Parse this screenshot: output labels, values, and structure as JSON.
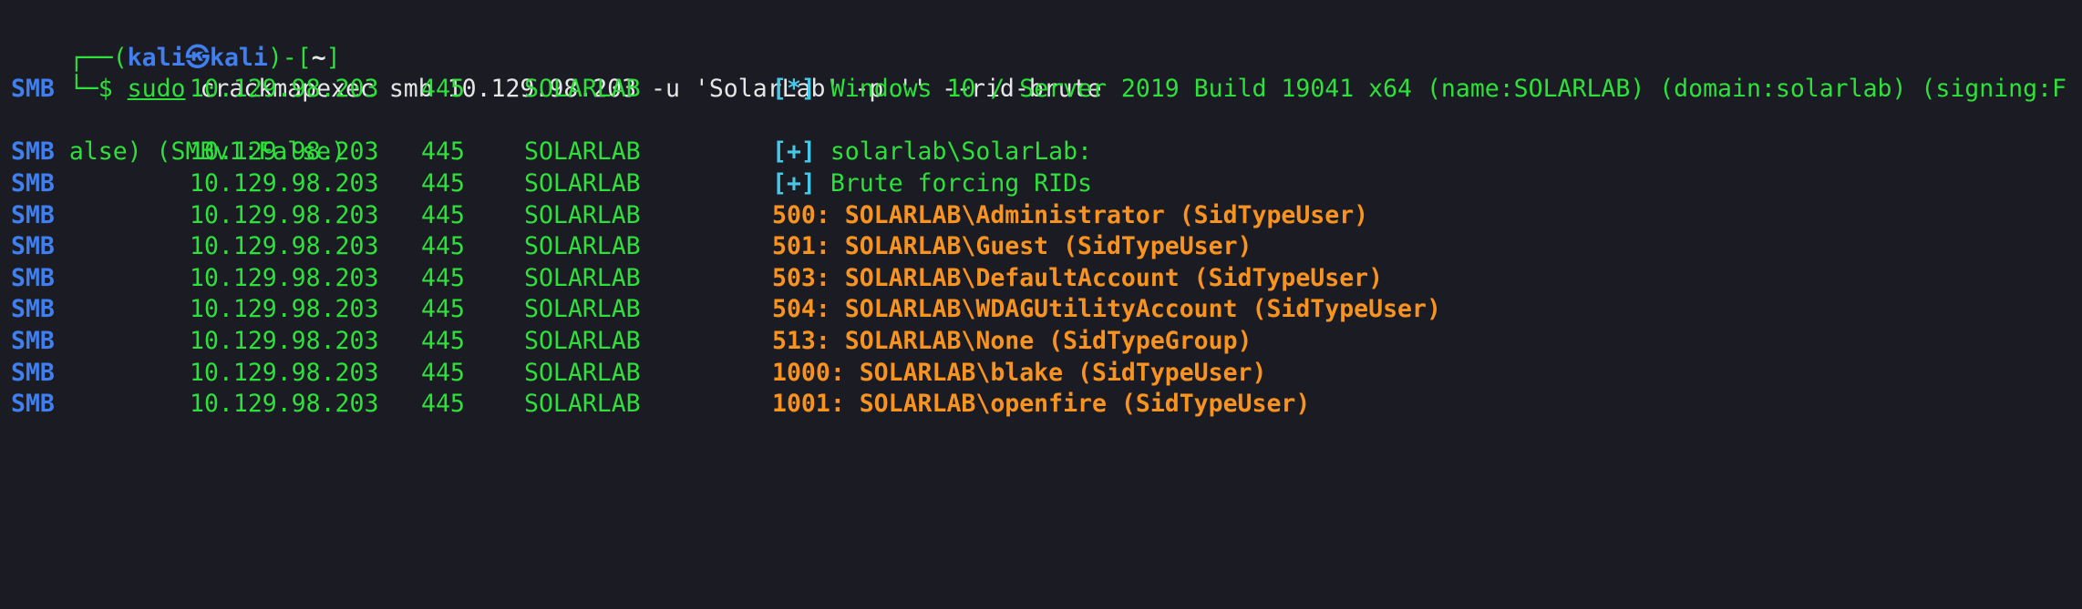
{
  "prompt": {
    "line1_prefix": "┌──(",
    "user": "kali",
    "at": "㉿",
    "host": "kali",
    "mid": ")-[",
    "path": "~",
    "end": "]",
    "line2_prefix": "└─$ ",
    "cmd_sudo": "sudo",
    "cmd_rest": " crackmapexec smb 10.129.98.203 -u 'SolarLab' -p '' --rid-brute"
  },
  "info_line": {
    "proto": "SMB",
    "ip": "10.129.98.203",
    "port": "445",
    "host": "SOLARLAB",
    "tag": "[*]",
    "text": " Windows 10 / Server 2019 Build 19041 x64 (name:SOLARLAB) (domain:solarlab) (signing:F",
    "wrap": "alse) (SMBv1:False)"
  },
  "plus_lines": [
    {
      "proto": "SMB",
      "ip": "10.129.98.203",
      "port": "445",
      "host": "SOLARLAB",
      "tag": "[+]",
      "text": " solarlab\\SolarLab:"
    },
    {
      "proto": "SMB",
      "ip": "10.129.98.203",
      "port": "445",
      "host": "SOLARLAB",
      "tag": "[+]",
      "text": " Brute forcing RIDs"
    }
  ],
  "rid_lines": [
    {
      "proto": "SMB",
      "ip": "10.129.98.203",
      "port": "445",
      "host": "SOLARLAB",
      "text": "500: SOLARLAB\\Administrator (SidTypeUser)"
    },
    {
      "proto": "SMB",
      "ip": "10.129.98.203",
      "port": "445",
      "host": "SOLARLAB",
      "text": "501: SOLARLAB\\Guest (SidTypeUser)"
    },
    {
      "proto": "SMB",
      "ip": "10.129.98.203",
      "port": "445",
      "host": "SOLARLAB",
      "text": "503: SOLARLAB\\DefaultAccount (SidTypeUser)"
    },
    {
      "proto": "SMB",
      "ip": "10.129.98.203",
      "port": "445",
      "host": "SOLARLAB",
      "text": "504: SOLARLAB\\WDAGUtilityAccount (SidTypeUser)"
    },
    {
      "proto": "SMB",
      "ip": "10.129.98.203",
      "port": "445",
      "host": "SOLARLAB",
      "text": "513: SOLARLAB\\None (SidTypeGroup)"
    },
    {
      "proto": "SMB",
      "ip": "10.129.98.203",
      "port": "445",
      "host": "SOLARLAB",
      "text": "1000: SOLARLAB\\blake (SidTypeUser)"
    },
    {
      "proto": "SMB",
      "ip": "10.129.98.203",
      "port": "445",
      "host": "SOLARLAB",
      "text": "1001: SOLARLAB\\openfire (SidTypeUser)"
    }
  ],
  "colors": {
    "background": "#1b1b24",
    "prompt_blue": "#3f7ff0",
    "green": "#2de13a",
    "orange": "#f7931e",
    "cyan": "#47c8e6"
  }
}
